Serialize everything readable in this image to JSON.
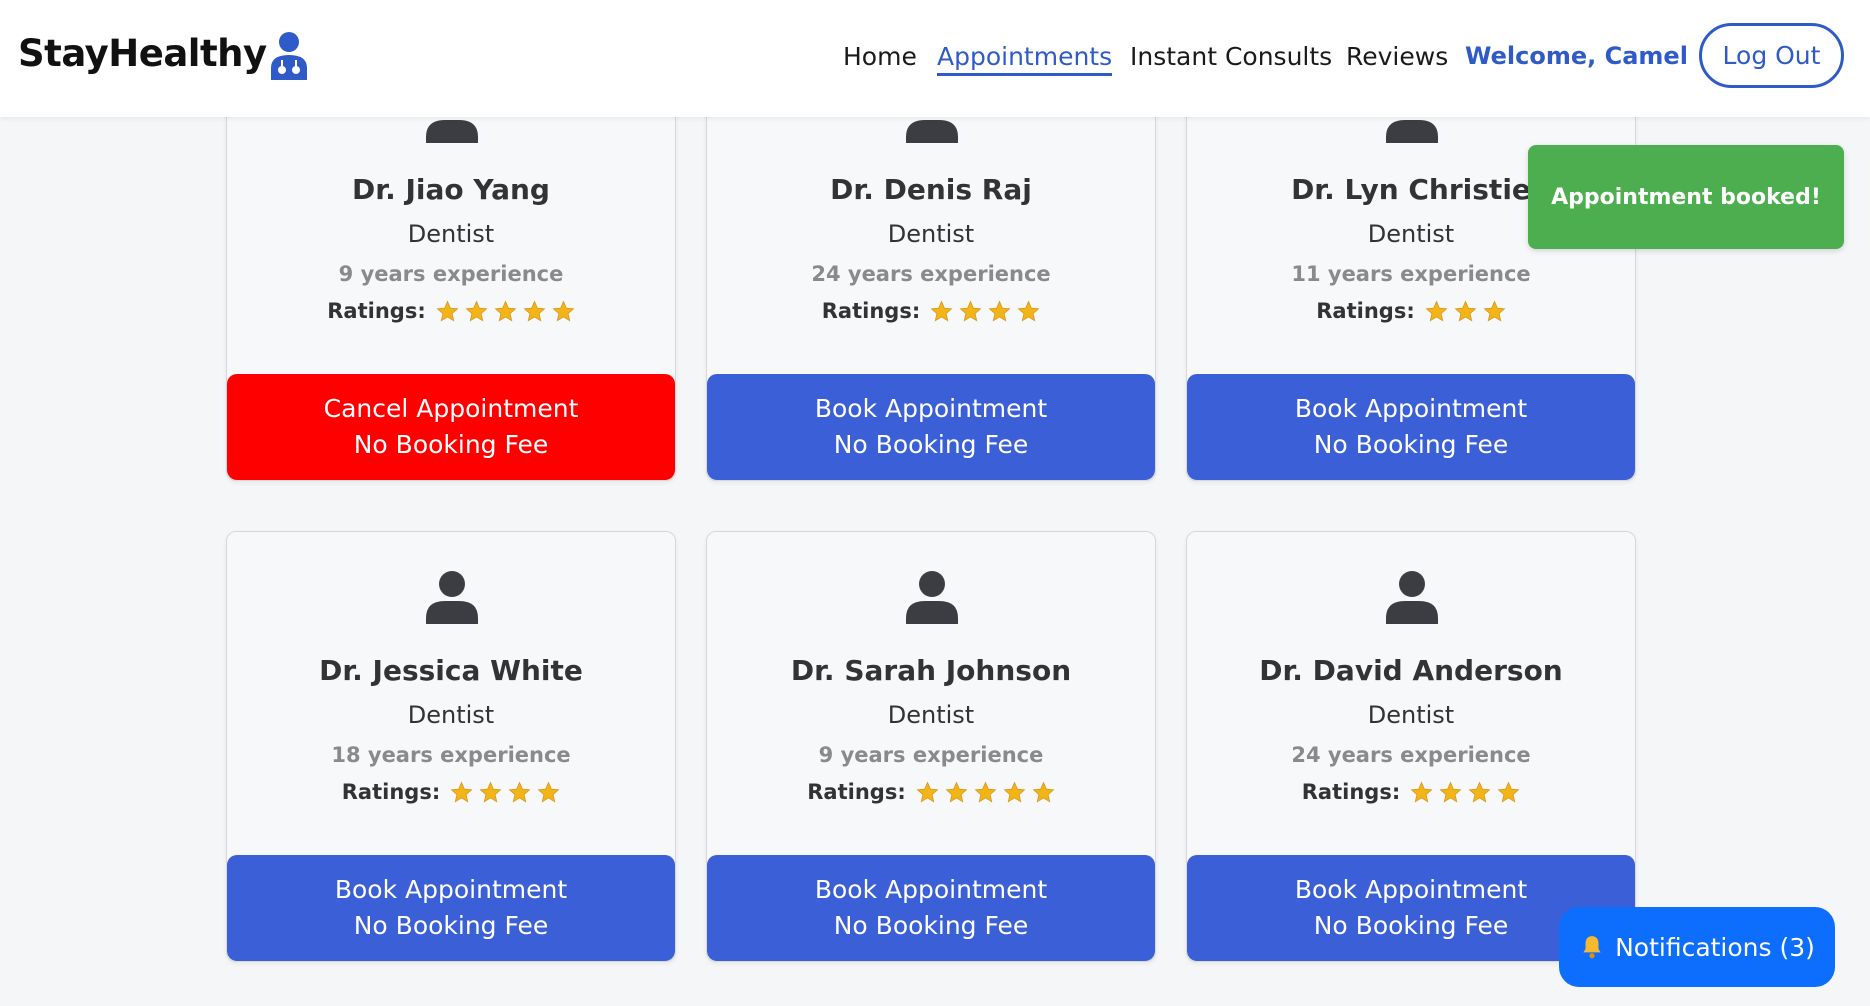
{
  "header": {
    "brand": "StayHealthy",
    "brand_icon": "doctor-icon",
    "nav": [
      "Home",
      "Appointments",
      "Instant Consults",
      "Reviews"
    ],
    "active_nav": "Appointments",
    "welcome": "Welcome, Camel",
    "logout": "Log Out"
  },
  "colors": {
    "accent": "#2f5bc9",
    "book_button": "#3a5fd6",
    "cancel_button": "#ff0000",
    "toast": "#4cae4f",
    "star": "#f2b416",
    "notification": "#0d6efd"
  },
  "doctors": [
    {
      "name": "Dr. Jiao Yang",
      "specialty": "Dentist",
      "experience": "9 years experience",
      "ratings_label": "Ratings:",
      "stars": 5,
      "button_line1": "Cancel Appointment",
      "button_line2": "No Booking Fee",
      "booked": true
    },
    {
      "name": "Dr. Denis Raj",
      "specialty": "Dentist",
      "experience": "24 years experience",
      "ratings_label": "Ratings:",
      "stars": 4,
      "button_line1": "Book Appointment",
      "button_line2": "No Booking Fee",
      "booked": false
    },
    {
      "name": "Dr. Lyn Christie",
      "specialty": "Dentist",
      "experience": "11 years experience",
      "ratings_label": "Ratings:",
      "stars": 3,
      "button_line1": "Book Appointment",
      "button_line2": "No Booking Fee",
      "booked": false
    },
    {
      "name": "Dr. Jessica White",
      "specialty": "Dentist",
      "experience": "18 years experience",
      "ratings_label": "Ratings:",
      "stars": 4,
      "button_line1": "Book Appointment",
      "button_line2": "No Booking Fee",
      "booked": false
    },
    {
      "name": "Dr. Sarah Johnson",
      "specialty": "Dentist",
      "experience": "9 years experience",
      "ratings_label": "Ratings:",
      "stars": 5,
      "button_line1": "Book Appointment",
      "button_line2": "No Booking Fee",
      "booked": false
    },
    {
      "name": "Dr. David Anderson",
      "specialty": "Dentist",
      "experience": "24 years experience",
      "ratings_label": "Ratings:",
      "stars": 4,
      "button_line1": "Book Appointment",
      "button_line2": "No Booking Fee",
      "booked": false
    }
  ],
  "toast": {
    "message": "Appointment booked!"
  },
  "notifications": {
    "label": "Notifications (3)",
    "icon": "bell-icon"
  }
}
